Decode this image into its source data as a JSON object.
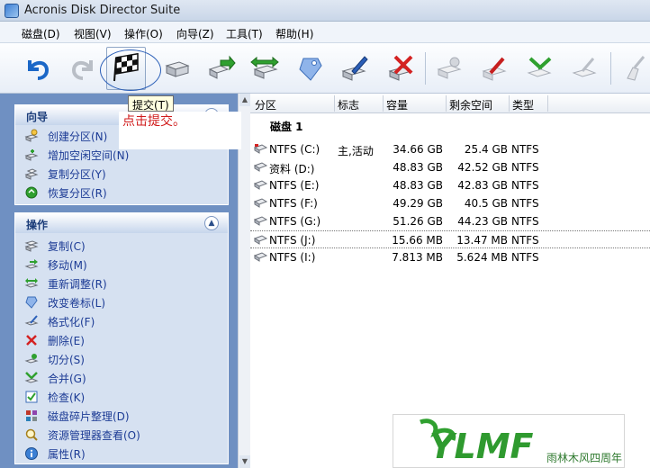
{
  "window": {
    "title": "Acronis Disk Director Suite"
  },
  "menu": [
    "磁盘(D)",
    "视图(V)",
    "操作(O)",
    "向导(Z)",
    "工具(T)",
    "帮助(H)"
  ],
  "tooltip": {
    "text": "提交(T)"
  },
  "annotation": {
    "text": "点击提交。"
  },
  "panels": {
    "wizard": {
      "title": "向导",
      "items": [
        "创建分区(N)",
        "增加空闲空间(N)",
        "复制分区(Y)",
        "恢复分区(R)"
      ]
    },
    "operations": {
      "title": "操作",
      "items": [
        "复制(C)",
        "移动(M)",
        "重新调整(R)",
        "改变卷标(L)",
        "格式化(F)",
        "删除(E)",
        "切分(S)",
        "合并(G)",
        "检查(K)",
        "磁盘碎片整理(D)",
        "资源管理器查看(O)",
        "属性(R)"
      ]
    }
  },
  "table": {
    "columns": [
      "分区",
      "标志",
      "容量",
      "剩余空间",
      "类型"
    ],
    "disk_label": "磁盘 1",
    "rows": [
      {
        "name": "NTFS (C:)",
        "flag": "主,活动",
        "capacity": "34.66 GB",
        "free": "25.4 GB",
        "type": "NTFS"
      },
      {
        "name": "资料 (D:)",
        "flag": "",
        "capacity": "48.83 GB",
        "free": "42.52 GB",
        "type": "NTFS"
      },
      {
        "name": "NTFS (E:)",
        "flag": "",
        "capacity": "48.83 GB",
        "free": "42.83 GB",
        "type": "NTFS"
      },
      {
        "name": "NTFS (F:)",
        "flag": "",
        "capacity": "49.29 GB",
        "free": "40.5 GB",
        "type": "NTFS"
      },
      {
        "name": "NTFS (G:)",
        "flag": "",
        "capacity": "51.26 GB",
        "free": "44.23 GB",
        "type": "NTFS"
      },
      {
        "name": "NTFS (J:)",
        "flag": "",
        "capacity": "15.66 MB",
        "free": "13.47 MB",
        "type": "NTFS"
      },
      {
        "name": "NTFS (I:)",
        "flag": "",
        "capacity": "7.813 MB",
        "free": "5.624 MB",
        "type": "NTFS"
      }
    ]
  },
  "logo": {
    "text": "YLMF",
    "caption": "雨林木风四周年"
  },
  "colors": {
    "accent": "#1c3b95",
    "annotation": "#d01a1a",
    "pane_bg": "#6f90c2"
  }
}
